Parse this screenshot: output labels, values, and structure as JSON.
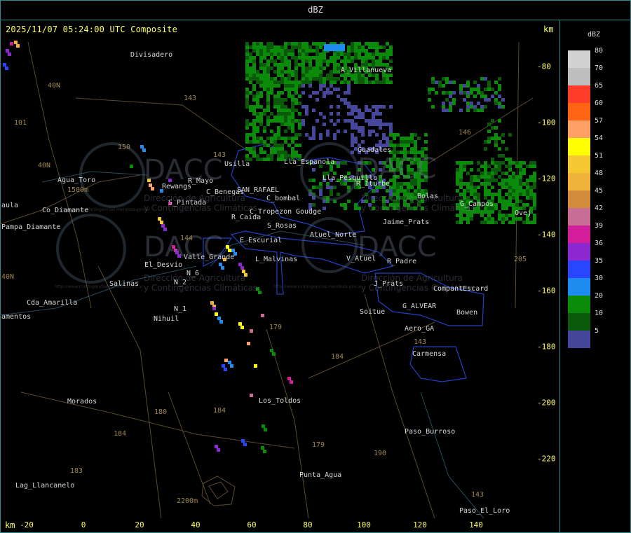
{
  "header": {
    "title": "dBZ"
  },
  "map": {
    "timestamp": "2025/11/07 05:24:00 UTC Composite",
    "unit_top": "km",
    "unit_bottom": "km",
    "x_ticks": [
      "-20",
      "0",
      "20",
      "40",
      "60",
      "80",
      "100",
      "120",
      "140"
    ],
    "y_ticks": [
      "-80",
      "-100",
      "-120",
      "-140",
      "-160",
      "-180",
      "-200",
      "-220"
    ],
    "watermark": {
      "brand": "DACC",
      "line1": "Dirección de Agricultura",
      "line2": "y Contingencias Climáticas",
      "url": "http://www.contingencias.mendoza.gov.ar"
    },
    "places": [
      "Divisadero",
      "A_Villanueva",
      "Guadales",
      "Usilla",
      "R_Mayo",
      "Rewangs",
      "S_Pintada",
      "C_Benegas",
      "SAN_RAFAEL",
      "C_bombal",
      "C_Tropezon",
      "Goudge",
      "R_Caida",
      "S_Rosas",
      "Atuel_Norte",
      "E_Escurial",
      "L_Malvinas",
      "Valle_Grande",
      "El_Desvio",
      "N_2",
      "N_6",
      "N_1",
      "Nihuil",
      "Salinas",
      "Cda_Amarilla",
      "amentos",
      "aula",
      "Pampa_Diamante",
      "Agua_Toro",
      "Co_Diamante",
      "V_Atuel",
      "R_Padre",
      "J_Prats",
      "CompantEscard",
      "G_ALVEAR",
      "Bowen",
      "Soitue",
      "Aero_GA",
      "Carmensa",
      "Los_Toldos",
      "Morados",
      "Paso_Burroso",
      "Punta_Agua",
      "Lag_Llancanelo",
      "Paso_El_Loro",
      "G_Campos",
      "Bolas",
      "Ovej",
      "Lla_Espanola",
      "Lla_Pesquillo",
      "R_Iturbe",
      "Jaime_Prats"
    ],
    "route_numbers": [
      "40N",
      "40N",
      "101",
      "143",
      "150",
      "143",
      "146",
      "144",
      "179",
      "184",
      "180",
      "184",
      "179",
      "190",
      "183",
      "184",
      "143",
      "143",
      "205",
      "40N",
      "1500m",
      "2200m"
    ]
  },
  "legend": {
    "title": "dBZ",
    "items": [
      {
        "label": "80",
        "color": "#d2d2d2"
      },
      {
        "label": "70",
        "color": "#bebebe"
      },
      {
        "label": "65",
        "color": "#ff3c28"
      },
      {
        "label": "60",
        "color": "#ff6414"
      },
      {
        "label": "57",
        "color": "#ffa064"
      },
      {
        "label": "54",
        "color": "#ffff00"
      },
      {
        "label": "51",
        "color": "#f5c832"
      },
      {
        "label": "48",
        "color": "#f0b43c"
      },
      {
        "label": "45",
        "color": "#d28c3c"
      },
      {
        "label": "42",
        "color": "#c86e96"
      },
      {
        "label": "39",
        "color": "#d21e9b"
      },
      {
        "label": "36",
        "color": "#8c28d2"
      },
      {
        "label": "35",
        "color": "#2846ff"
      },
      {
        "label": "30",
        "color": "#1e8cf0"
      },
      {
        "label": "20",
        "color": "#0a8c0a"
      },
      {
        "label": "10",
        "color": "#0a5a0a"
      },
      {
        "label": "5",
        "color": "#46469b"
      }
    ]
  }
}
